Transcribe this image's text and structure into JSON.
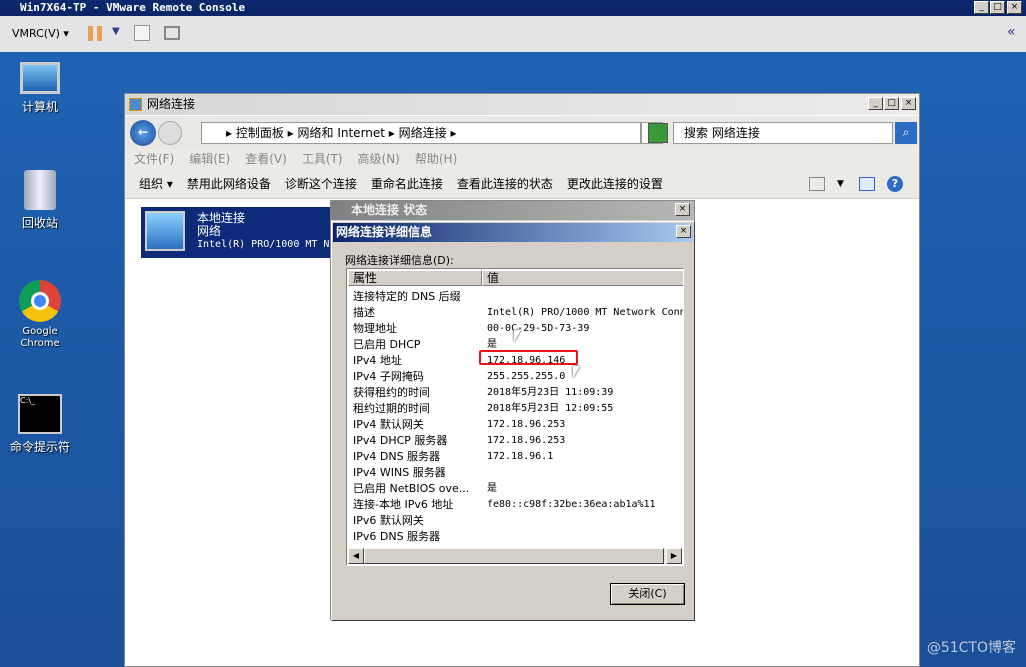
{
  "vmrc": {
    "title": "Win7X64-TP - VMware Remote Console",
    "menu_label": "VMRC(V)",
    "min": "_",
    "max": "□",
    "close": "×",
    "collapse": "«"
  },
  "desktop": {
    "icons": [
      {
        "label": "计算机"
      },
      {
        "label": "回收站"
      },
      {
        "label": "Google Chrome"
      },
      {
        "label": "命令提示符"
      }
    ]
  },
  "explorer": {
    "title": "网络连接",
    "breadcrumb": [
      "控制面板",
      "网络和 Internet",
      "网络连接"
    ],
    "search_placeholder": "搜索 网络连接",
    "menu": [
      "文件(F)",
      "编辑(E)",
      "查看(V)",
      "工具(T)",
      "高级(N)",
      "帮助(H)"
    ],
    "commands": [
      "组织 ▾",
      "禁用此网络设备",
      "诊断这个连接",
      "重命名此连接",
      "查看此连接的状态",
      "更改此连接的设置"
    ],
    "item": {
      "name": "本地连接",
      "network": "网络",
      "adapter": "Intel(R) PRO/1000 MT N"
    }
  },
  "status_dialog": {
    "title": "本地连接 状态"
  },
  "details_dialog": {
    "title": "网络连接详细信息",
    "label": "网络连接详细信息(D):",
    "columns": [
      "属性",
      "值"
    ],
    "rows": [
      {
        "k": "连接特定的 DNS 后缀",
        "v": ""
      },
      {
        "k": "描述",
        "v": "Intel(R) PRO/1000 MT Network Conn"
      },
      {
        "k": "物理地址",
        "v": "00-0C-29-5D-73-39"
      },
      {
        "k": "已启用 DHCP",
        "v": "是"
      },
      {
        "k": "IPv4 地址",
        "v": "172.18.96.146"
      },
      {
        "k": "IPv4 子网掩码",
        "v": "255.255.255.0"
      },
      {
        "k": "获得租约的时间",
        "v": "2018年5月23日 11:09:39"
      },
      {
        "k": "租约过期的时间",
        "v": "2018年5月23日 12:09:55"
      },
      {
        "k": "IPv4 默认网关",
        "v": "172.18.96.253"
      },
      {
        "k": "IPv4 DHCP 服务器",
        "v": "172.18.96.253"
      },
      {
        "k": "IPv4 DNS 服务器",
        "v": "172.18.96.1"
      },
      {
        "k": "IPv4 WINS 服务器",
        "v": ""
      },
      {
        "k": "已启用 NetBIOS ove...",
        "v": "是"
      },
      {
        "k": "连接-本地 IPv6 地址",
        "v": "fe80::c98f:32be:36ea:ab1a%11"
      },
      {
        "k": "IPv6 默认网关",
        "v": ""
      },
      {
        "k": "IPv6 DNS 服务器",
        "v": ""
      }
    ],
    "close_label": "关闭(C)"
  },
  "watermark": "@51CTO博客"
}
